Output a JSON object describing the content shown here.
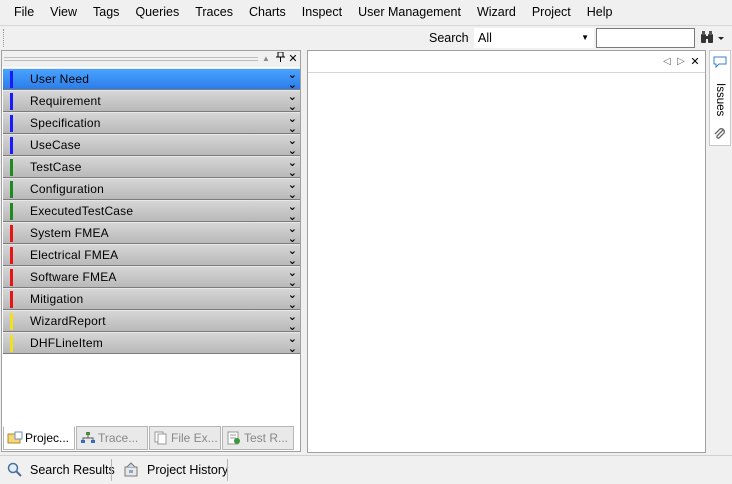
{
  "menu": [
    "File",
    "View",
    "Tags",
    "Queries",
    "Traces",
    "Charts",
    "Inspect",
    "User Management",
    "Wizard",
    "Project",
    "Help"
  ],
  "toolbar": {
    "search_label": "Search",
    "search_scope": "All",
    "search_query": ""
  },
  "categories": [
    {
      "label": "User Need",
      "color": "#1a1aff",
      "selected": true
    },
    {
      "label": "Requirement",
      "color": "#1a1aff"
    },
    {
      "label": "Specification",
      "color": "#1a1aff"
    },
    {
      "label": "UseCase",
      "color": "#1a1aff"
    },
    {
      "label": "TestCase",
      "color": "#1f8a1f"
    },
    {
      "label": "Configuration",
      "color": "#1f8a1f"
    },
    {
      "label": "ExecutedTestCase",
      "color": "#1f8a1f"
    },
    {
      "label": "System FMEA",
      "color": "#e81414"
    },
    {
      "label": "Electrical FMEA",
      "color": "#e81414"
    },
    {
      "label": "Software FMEA",
      "color": "#e81414"
    },
    {
      "label": "Mitigation",
      "color": "#e81414"
    },
    {
      "label": "WizardReport",
      "color": "#f0e020"
    },
    {
      "label": "DHFLineItem",
      "color": "#f0e020"
    }
  ],
  "left_tabs": [
    {
      "label": "Projec...",
      "icon": "project-icon",
      "active": true
    },
    {
      "label": "Trace...",
      "icon": "trace-tree-icon"
    },
    {
      "label": "File Ex...",
      "icon": "file-explorer-icon"
    },
    {
      "label": "Test R...",
      "icon": "test-results-icon"
    }
  ],
  "right_sidebar": {
    "issues_label": "Issues"
  },
  "bottom_tabs": [
    {
      "label": "Search Results",
      "icon": "search-icon"
    },
    {
      "label": "Project History",
      "icon": "history-icon"
    }
  ],
  "colors": {
    "selected_top": "#4aa3ff",
    "selected_bottom": "#2b7de9"
  }
}
